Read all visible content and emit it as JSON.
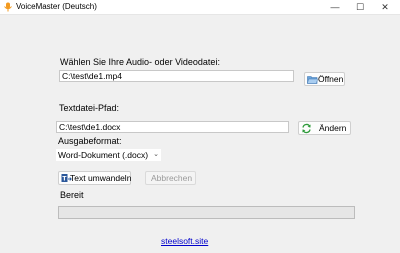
{
  "window": {
    "title": "VoiceMaster (Deutsch)"
  },
  "title_controls": {
    "minimize": "—",
    "maximize": "☐",
    "close": "✕"
  },
  "input_file": {
    "label": "Wählen Sie Ihre Audio- oder Videodatei:",
    "value": "C:\\test\\de1.mp4",
    "open_button": "Öffnen"
  },
  "output_file": {
    "label": "Textdatei-Pfad:",
    "value": "C:\\test\\de1.docx",
    "change_button": "Ändern"
  },
  "format": {
    "label": "Ausgabeformat:",
    "selected": "Word-Dokument (.docx)"
  },
  "actions": {
    "convert_button": "Text umwandeln",
    "cancel_button": "Abbrechen"
  },
  "status": {
    "text": "Bereit",
    "progress": 0
  },
  "footer": {
    "link": "steelsoft.site"
  },
  "colors": {
    "progress_fill": "#06b025",
    "link": "#0000cc"
  }
}
